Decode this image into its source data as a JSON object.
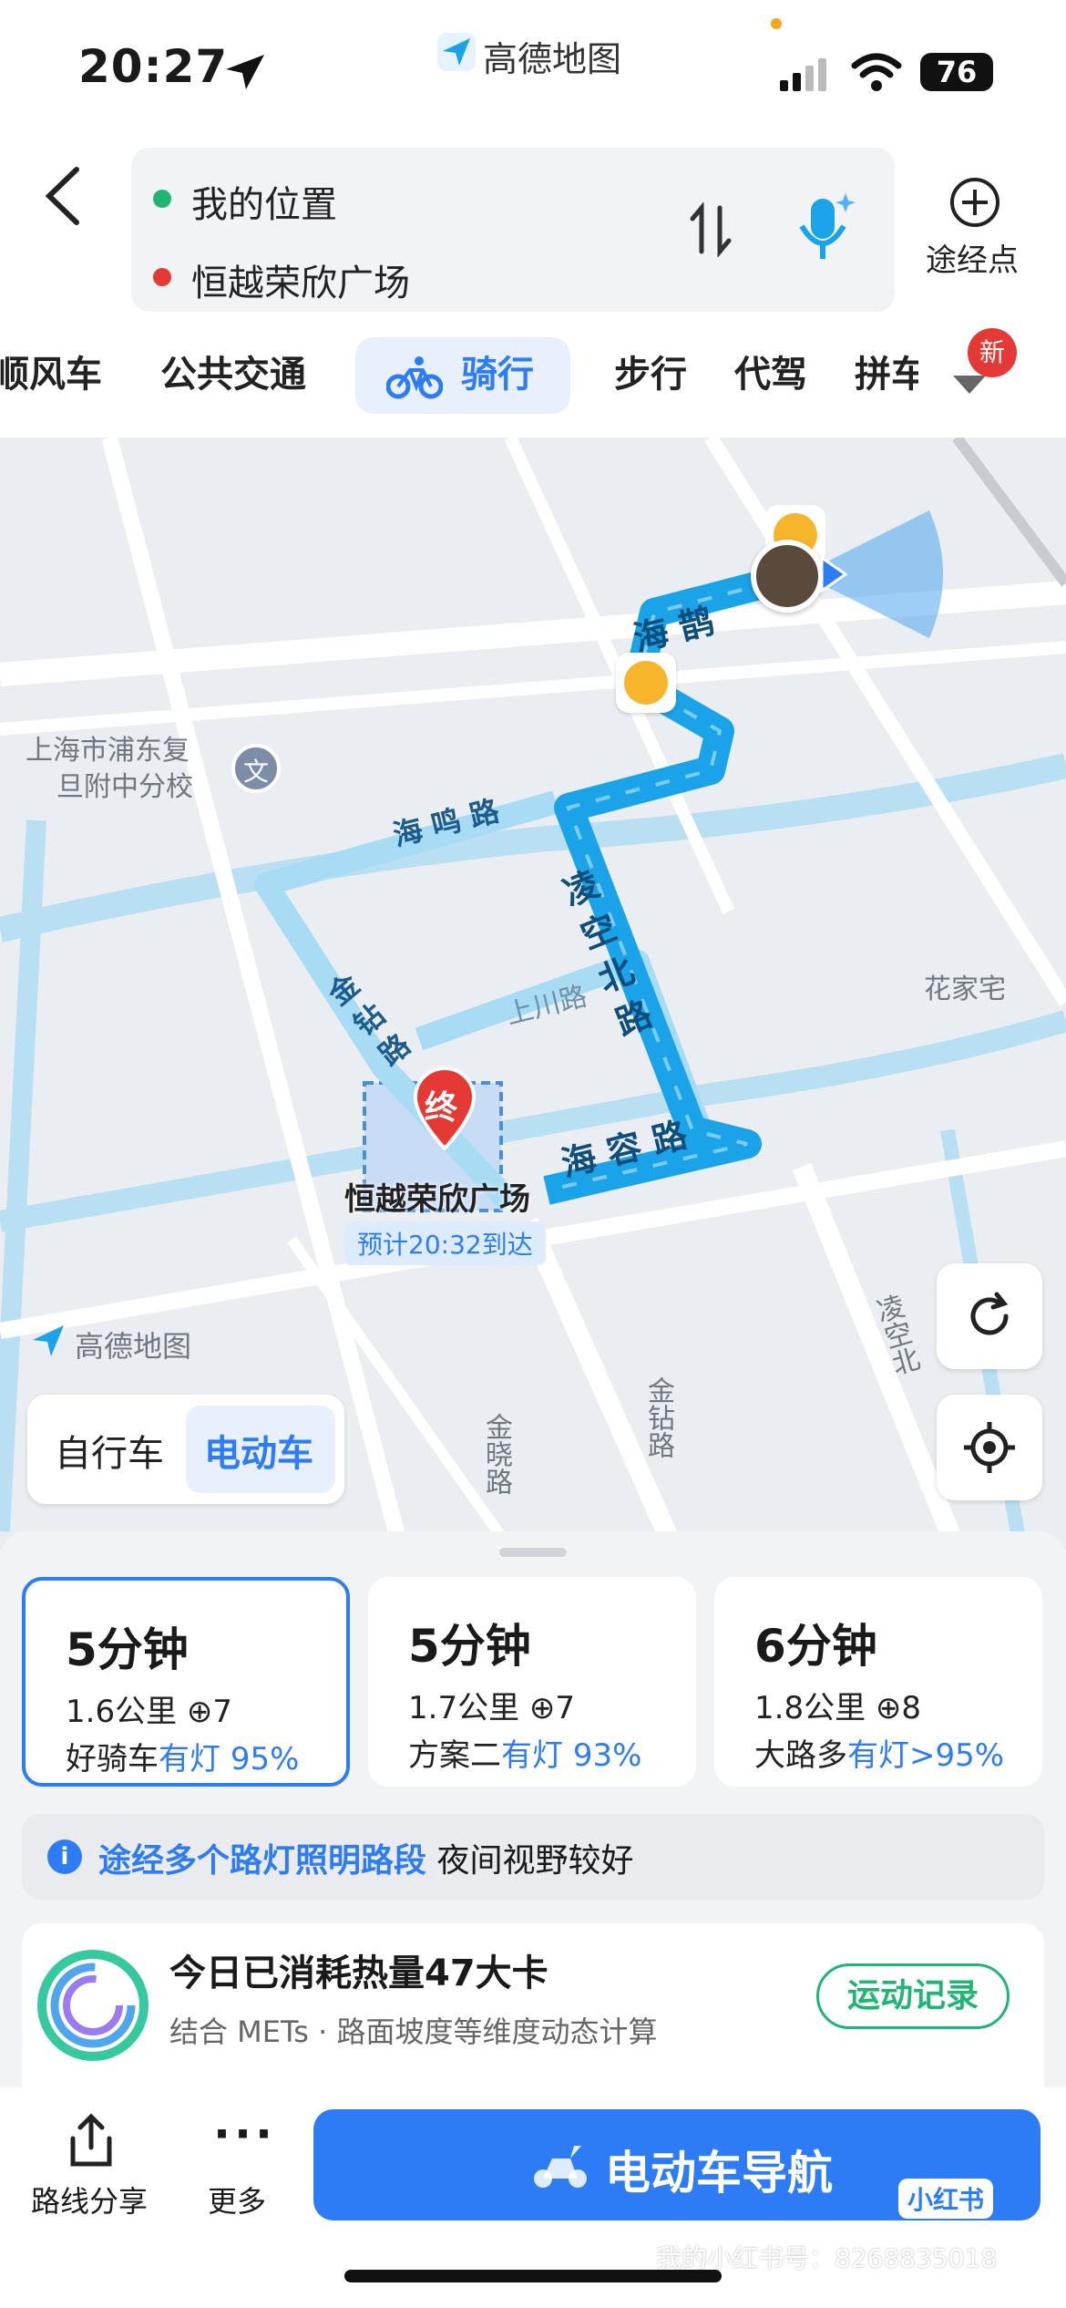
{
  "status_bar": {
    "time": "20:27",
    "app_name": "高德地图",
    "battery": "76"
  },
  "header": {
    "origin": "我的位置",
    "destination": "恒越荣欣广场",
    "waypoint_label": "途经点"
  },
  "transport_tabs": {
    "items": [
      {
        "label": "顺风车"
      },
      {
        "label": "公共交通"
      },
      {
        "label": "骑行"
      },
      {
        "label": "步行"
      },
      {
        "label": "代驾"
      },
      {
        "label": "拼车"
      }
    ],
    "active": "骑行",
    "new_badge": "新"
  },
  "map": {
    "labels": {
      "school": "上海市浦东复旦附中分校",
      "school_l1": "上海市浦东复",
      "school_l2": "旦附中分校",
      "school_badge": "文",
      "haiming_rd": "海 鸣 路",
      "lingkong_north_rd": "凌 空 北 路",
      "shangchuan_rd": "上川路",
      "jinzuan_rd": "金 钻 路",
      "hairong_rd": "海 容 路",
      "haique_rd": "海 鹊",
      "huajiazhai": "花家宅",
      "jinxiao_rd": "金晓路",
      "jinzuan_rd2": "金钻路",
      "lingkong_north2": "凌空北",
      "watermark_logo": "高德地图"
    },
    "destination_marker": "终",
    "destination_name": "恒越荣欣广场",
    "eta": "预计20:32到达",
    "colors": {
      "route": "#1aa3e8",
      "alt_route": "#a8dcf5",
      "water": "#b9dff3",
      "road": "#ffffff"
    }
  },
  "vehicle_mode": {
    "options": [
      "自行车",
      "电动车"
    ],
    "active": "电动车"
  },
  "routes": [
    {
      "time": "5分钟",
      "distance": "1.6公里",
      "lights": "7",
      "tag": "好骑车",
      "light_text": "有灯",
      "light_pct": "95%",
      "selected": true
    },
    {
      "time": "5分钟",
      "distance": "1.7公里",
      "lights": "7",
      "tag": "方案二",
      "light_text": "有灯",
      "light_pct": "93%",
      "selected": false
    },
    {
      "time": "6分钟",
      "distance": "1.8公里",
      "lights": "8",
      "tag": "大路多",
      "light_text": "有灯",
      "light_pct": ">95%",
      "selected": false
    }
  ],
  "info_bar": {
    "highlight": "途经多个路灯照明路段",
    "text": "夜间视野较好"
  },
  "calories": {
    "title": "今日已消耗热量47大卡",
    "subtitle": "结合 METs · 路面坡度等维度动态计算",
    "button": "运动记录"
  },
  "bottom_bar": {
    "share_label": "路线分享",
    "more_label": "更多",
    "nav_label": "电动车导航",
    "watermark_badge": "小红书",
    "watermark_text": "我的小红书号：8268835018"
  },
  "accent_color": "#2d7cf6"
}
